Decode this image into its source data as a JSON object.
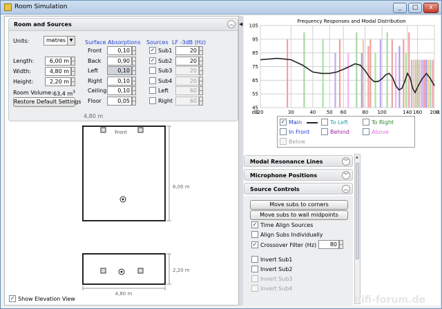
{
  "window": {
    "title": "Room Simulation",
    "controls": [
      "_",
      "□",
      "x"
    ]
  },
  "room_sources": {
    "title": "Room and Sources",
    "units_label": "Units:",
    "units_value": "metres",
    "length_label": "Length:",
    "length_value": "6,00 m",
    "width_label": "Width:",
    "width_value": "4,80 m",
    "height_label": "Height:",
    "height_value": "2,20 m",
    "volume_label": "Room Volume:",
    "volume_value": "63,4 m",
    "volume_sup": "3",
    "restore_button": "Restore Default Settings",
    "absorptions_header": "Surface Absorptions",
    "absorptions": [
      {
        "label": "Front",
        "value": "0,10"
      },
      {
        "label": "Back",
        "value": "0,90"
      },
      {
        "label": "Left",
        "value": "0,10"
      },
      {
        "label": "Right",
        "value": "0,10"
      },
      {
        "label": "Ceiling",
        "value": "0,10"
      },
      {
        "label": "Floor",
        "value": "0,05"
      }
    ],
    "sources_header": "Sources",
    "lf_header": "LF -3dB (Hz)",
    "sources": [
      {
        "label": "Sub1",
        "checked": true,
        "value": "20"
      },
      {
        "label": "Sub2",
        "checked": true,
        "value": "20"
      },
      {
        "label": "Sub3",
        "checked": false,
        "value": "20"
      },
      {
        "label": "Sub4",
        "checked": false,
        "value": "20"
      },
      {
        "label": "Left",
        "checked": false,
        "value": "60"
      },
      {
        "label": "Right",
        "checked": false,
        "value": "60"
      }
    ]
  },
  "plan_view": {
    "top_dim": "4,80 m",
    "side_dim": "6,00 m",
    "front_label": "Front",
    "elev_side_dim": "2,20 m",
    "elev_bottom_dim": "4,80 m",
    "show_elevation_label": "Show Elevation View",
    "show_elevation_checked": true
  },
  "chart_data": {
    "type": "line",
    "title": "Frequency Responses and Modal Distribution",
    "ylabel": "dB",
    "xlabel": "Hz",
    "ylim": [
      45,
      105
    ],
    "xlim": [
      20,
      200
    ],
    "yticks": [
      "105",
      "95",
      "85",
      "75",
      "65",
      "55",
      "45"
    ],
    "xticks": [
      "20",
      "30",
      "40",
      "50",
      "60",
      "80",
      "100",
      "140",
      "160",
      "200"
    ],
    "grid": true,
    "series": [
      {
        "name": "Main",
        "x": [
          20,
          25,
          30,
          35,
          40,
          45,
          50,
          55,
          60,
          65,
          70,
          75,
          80,
          85,
          90,
          95,
          100,
          105,
          110,
          115,
          120,
          125,
          130,
          135,
          140,
          145,
          150,
          155,
          160,
          170,
          180,
          190,
          200
        ],
        "y": [
          80,
          81,
          80,
          76,
          71,
          70,
          70,
          71,
          73,
          75,
          77,
          76,
          72,
          67,
          64,
          64,
          66,
          69,
          70,
          67,
          61,
          58,
          59,
          64,
          70,
          67,
          59,
          56,
          60,
          66,
          70,
          66,
          61
        ]
      },
      {
        "name": "To Left",
        "x": [],
        "y": []
      },
      {
        "name": "To Right",
        "x": [],
        "y": []
      },
      {
        "name": "In Front",
        "x": [],
        "y": []
      },
      {
        "name": "Behind",
        "x": [],
        "y": []
      },
      {
        "name": "Above",
        "x": [],
        "y": []
      },
      {
        "name": "Below",
        "x": [],
        "y": []
      }
    ],
    "modes": [
      {
        "f": 28.6,
        "color": "#f2a0a0",
        "top": 95
      },
      {
        "f": 35.7,
        "color": "#a8d8a8",
        "top": 100
      },
      {
        "f": 45.8,
        "color": "#a0e8a0",
        "top": 95
      },
      {
        "f": 53.9,
        "color": "#c0a8f0",
        "top": 85
      },
      {
        "f": 57.2,
        "color": "#f2a0a0",
        "top": 95
      },
      {
        "f": 64.0,
        "color": "#f5b0f5",
        "top": 85
      },
      {
        "f": 71.4,
        "color": "#a8d8a8",
        "top": 100
      },
      {
        "f": 76.5,
        "color": "#a0a0f0",
        "top": 85
      },
      {
        "f": 78.0,
        "color": "#f5c6a0",
        "top": 95
      },
      {
        "f": 83.5,
        "color": "#f2a0a0",
        "top": 90
      },
      {
        "f": 85.8,
        "color": "#f2a0a0",
        "top": 95
      },
      {
        "f": 91.6,
        "color": "#a0e8a0",
        "top": 85
      },
      {
        "f": 98.0,
        "color": "#c0a8f0",
        "top": 95
      },
      {
        "f": 107.1,
        "color": "#a8d8a8",
        "top": 100
      },
      {
        "f": 114.4,
        "color": "#f2a0a0",
        "top": 95
      },
      {
        "f": 120.0,
        "color": "#f5b0f5",
        "top": 85
      },
      {
        "f": 126.0,
        "color": "#a0a0f0",
        "top": 90
      },
      {
        "f": 133.0,
        "color": "#f2a0a0",
        "top": 95
      },
      {
        "f": 137.4,
        "color": "#a0e8a0",
        "top": 85
      },
      {
        "f": 143.0,
        "color": "#f2a0a0",
        "top": 100
      },
      {
        "f": 148.0,
        "color": "#d0b0f0",
        "top": 80
      },
      {
        "f": 152.0,
        "color": "#f5c6a0",
        "top": 80
      },
      {
        "f": 156.0,
        "color": "#a8d8a8",
        "top": 80
      },
      {
        "f": 160.0,
        "color": "#f2a0a0",
        "top": 80
      },
      {
        "f": 164.0,
        "color": "#a0e8a0",
        "top": 80
      },
      {
        "f": 168.0,
        "color": "#f5b0f5",
        "top": 80
      },
      {
        "f": 172.0,
        "color": "#c0a8f0",
        "top": 80
      },
      {
        "f": 176.0,
        "color": "#f2a0a0",
        "top": 80
      },
      {
        "f": 180.0,
        "color": "#a0a0f0",
        "top": 80
      },
      {
        "f": 185.0,
        "color": "#f5c6a0",
        "top": 80
      },
      {
        "f": 190.0,
        "color": "#a8d8a8",
        "top": 80
      },
      {
        "f": 196.0,
        "color": "#f2a0a0",
        "top": 80
      }
    ]
  },
  "legend": {
    "items": [
      {
        "label": "Main",
        "checked": true,
        "color": "#1f3fd0"
      },
      {
        "label": "To Left",
        "checked": false,
        "color": "#2aa0a0"
      },
      {
        "label": "To Right",
        "checked": false,
        "color": "#2a8a2a"
      },
      {
        "label": "In Front",
        "checked": false,
        "color": "#1f3fd0"
      },
      {
        "label": "Behind",
        "checked": false,
        "color": "#a020a0"
      },
      {
        "label": "Above",
        "checked": false,
        "color": "#e070e0"
      },
      {
        "label": "Below",
        "checked": false,
        "color": "#a0a0a0"
      }
    ]
  },
  "panels": {
    "modal_lines": "Modal Resonance Lines",
    "mic_positions": "Microphone Positions",
    "source_controls": "Source Controls",
    "move_corners": "Move subs to corners",
    "move_midpoints": "Move subs to wall midpoints",
    "time_align": "Time Align Sources",
    "align_individually": "Align Subs Individually",
    "crossover": "Crossover Filter (Hz)",
    "crossover_value": "80",
    "invert": [
      "Invert Sub1",
      "Invert Sub2",
      "Invert Sub3",
      "Invert Sub4"
    ]
  },
  "watermark": "hifi-forum.de"
}
